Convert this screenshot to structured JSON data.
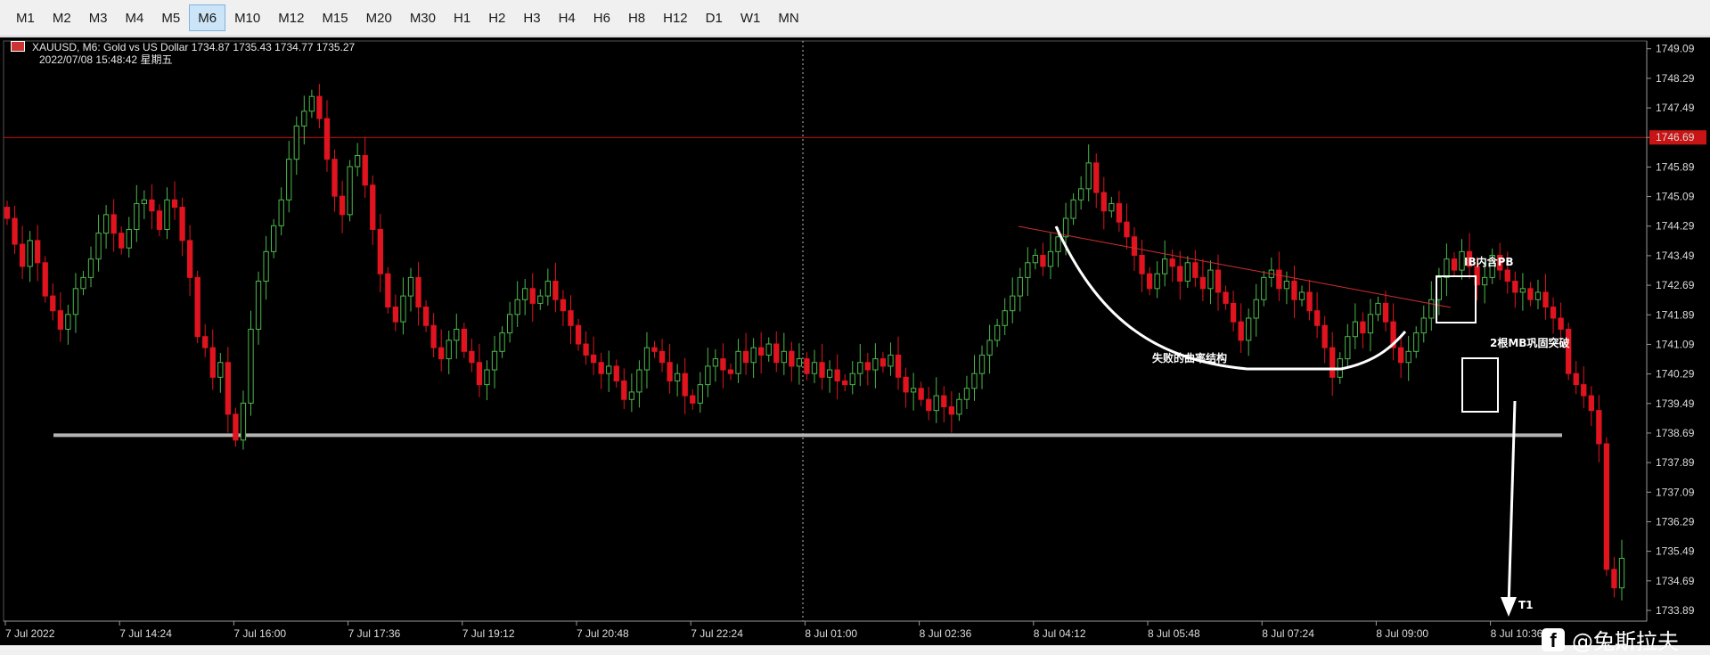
{
  "toolbar": {
    "timeframes": [
      "M1",
      "M2",
      "M3",
      "M4",
      "M5",
      "M6",
      "M10",
      "M12",
      "M15",
      "M20",
      "M30",
      "H1",
      "H2",
      "H3",
      "H4",
      "H6",
      "H8",
      "H12",
      "D1",
      "W1",
      "MN"
    ],
    "active": "M6"
  },
  "info": {
    "symbol_line": "XAUUSD, M6:  Gold vs US Dollar  1734.87 1735.43 1734.77 1735.27",
    "time_line": "2022/07/08 15:48:42 星期五"
  },
  "colors": {
    "up": "#4cb84c",
    "down": "#e0141e",
    "background": "#000000",
    "resistance": "#c81414",
    "support": "#b4b4b4",
    "annotation": "#ffffff"
  },
  "price_axis": {
    "labels": [
      "1749.09",
      "1748.29",
      "1747.49",
      "1746.69",
      "1745.89",
      "1745.09",
      "1744.29",
      "1743.49",
      "1742.69",
      "1741.89",
      "1741.09",
      "1740.29",
      "1739.49",
      "1738.69",
      "1737.89",
      "1737.09",
      "1736.29",
      "1735.49",
      "1734.69",
      "1733.89"
    ],
    "current_price": "1746.69"
  },
  "time_axis": {
    "labels": [
      "7 Jul 2022",
      "7 Jul 14:24",
      "7 Jul 16:00",
      "7 Jul 17:36",
      "7 Jul 19:12",
      "7 Jul 20:48",
      "7 Jul 22:24",
      "8 Jul 01:00",
      "8 Jul 02:36",
      "8 Jul 04:12",
      "8 Jul 05:48",
      "8 Jul 07:24",
      "8 Jul 09:00",
      "8 Jul 10:36"
    ]
  },
  "chart_data": {
    "type": "candlestick",
    "symbol": "XAUUSD",
    "timeframe": "M6",
    "ylim": [
      1733.6,
      1749.3
    ],
    "resistance_price": 1746.69,
    "support_price": 1738.63,
    "closes": [
      1744.5,
      1743.8,
      1743.2,
      1743.9,
      1743.3,
      1742.4,
      1742.0,
      1741.5,
      1741.9,
      1742.6,
      1742.9,
      1743.4,
      1744.1,
      1744.6,
      1744.1,
      1743.7,
      1744.2,
      1744.9,
      1745.0,
      1744.7,
      1744.2,
      1745.0,
      1744.8,
      1743.9,
      1742.9,
      1741.3,
      1741.0,
      1740.2,
      1740.6,
      1739.2,
      1738.5,
      1739.5,
      1741.5,
      1742.8,
      1743.6,
      1744.3,
      1745.0,
      1746.1,
      1747.0,
      1747.4,
      1747.8,
      1747.2,
      1746.1,
      1745.1,
      1744.6,
      1745.9,
      1746.2,
      1745.4,
      1744.2,
      1743.0,
      1742.1,
      1741.7,
      1742.4,
      1742.9,
      1742.1,
      1741.6,
      1741.0,
      1740.7,
      1741.2,
      1741.5,
      1740.9,
      1740.6,
      1740.0,
      1740.4,
      1740.9,
      1741.4,
      1741.9,
      1742.3,
      1742.6,
      1742.2,
      1742.4,
      1742.8,
      1742.3,
      1742.0,
      1741.6,
      1741.1,
      1740.8,
      1740.6,
      1740.3,
      1740.5,
      1740.1,
      1739.6,
      1739.8,
      1740.4,
      1741.0,
      1740.9,
      1740.6,
      1740.1,
      1740.3,
      1739.7,
      1739.5,
      1740.0,
      1740.5,
      1740.7,
      1740.4,
      1740.3,
      1740.9,
      1740.6,
      1741.0,
      1740.8,
      1741.1,
      1740.6,
      1740.9,
      1740.5,
      1740.7,
      1740.3,
      1740.6,
      1740.2,
      1740.4,
      1740.1,
      1740.0,
      1740.3,
      1740.6,
      1740.4,
      1740.7,
      1740.5,
      1740.8,
      1740.2,
      1739.8,
      1739.9,
      1739.6,
      1739.3,
      1739.7,
      1739.4,
      1739.2,
      1739.6,
      1739.9,
      1740.3,
      1740.8,
      1741.2,
      1741.6,
      1742.0,
      1742.4,
      1742.9,
      1743.3,
      1743.5,
      1743.2,
      1743.6,
      1744.0,
      1744.5,
      1745.0,
      1745.3,
      1746.0,
      1745.2,
      1744.7,
      1744.9,
      1744.4,
      1744.0,
      1743.5,
      1743.0,
      1742.6,
      1743.0,
      1743.4,
      1743.2,
      1742.8,
      1743.3,
      1742.9,
      1742.6,
      1743.1,
      1742.5,
      1742.2,
      1741.7,
      1741.2,
      1741.8,
      1742.3,
      1742.9,
      1743.1,
      1742.6,
      1742.8,
      1742.3,
      1742.5,
      1742.0,
      1741.6,
      1741.0,
      1740.2,
      1740.7,
      1741.3,
      1741.7,
      1741.4,
      1741.9,
      1742.2,
      1741.7,
      1741.0,
      1740.6,
      1740.9,
      1741.4,
      1741.8,
      1742.3,
      1742.9,
      1743.4,
      1743.1,
      1743.6,
      1743.2,
      1742.7,
      1742.9,
      1743.5,
      1743.1,
      1742.8,
      1742.5,
      1742.6,
      1742.3,
      1742.5,
      1742.1,
      1741.8,
      1741.5,
      1740.3,
      1740.0,
      1739.7,
      1739.3,
      1738.4,
      1735.0,
      1734.5,
      1735.3
    ]
  },
  "annotations": {
    "curve_label": "失败的曲率结构",
    "ib_label": "IB内含PB",
    "mb_label": "2根MB巩固突破",
    "target_label": "T1"
  },
  "watermark": {
    "icon": "facebook-icon",
    "text": "@兔斯拉夫"
  }
}
